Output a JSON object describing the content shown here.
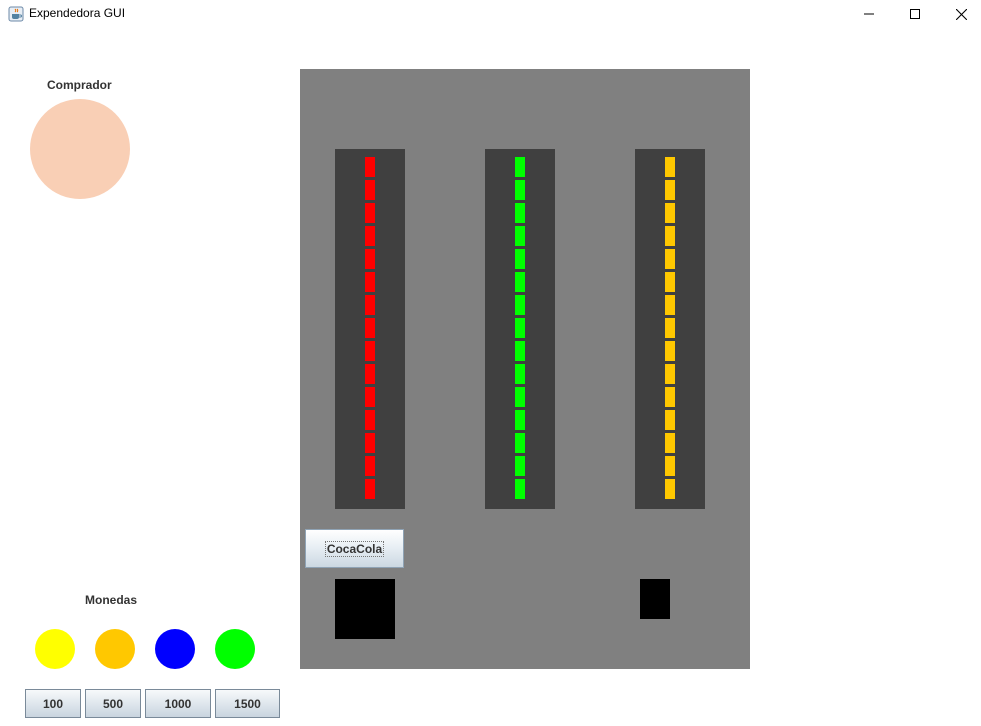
{
  "window": {
    "title": "Expendedora GUI",
    "app_icon": "java-cup-icon",
    "controls": [
      "minimize-icon",
      "maximize-icon",
      "close-icon"
    ]
  },
  "buyer": {
    "label": "Comprador",
    "color": "#f9cfb5"
  },
  "coins": {
    "label": "Monedas",
    "items": [
      {
        "value": "100",
        "color": "#ffff00"
      },
      {
        "value": "500",
        "color": "#ffc800"
      },
      {
        "value": "1000",
        "color": "#0000ff"
      },
      {
        "value": "1500",
        "color": "#00ff00"
      }
    ]
  },
  "machine": {
    "background": "#808080",
    "column_color": "#404040",
    "columns": [
      {
        "slot_color": "#ff0000",
        "count": 15
      },
      {
        "slot_color": "#00ff00",
        "count": 15
      },
      {
        "slot_color": "#ffc800",
        "count": 15
      }
    ],
    "product_button": "CocaCola"
  }
}
